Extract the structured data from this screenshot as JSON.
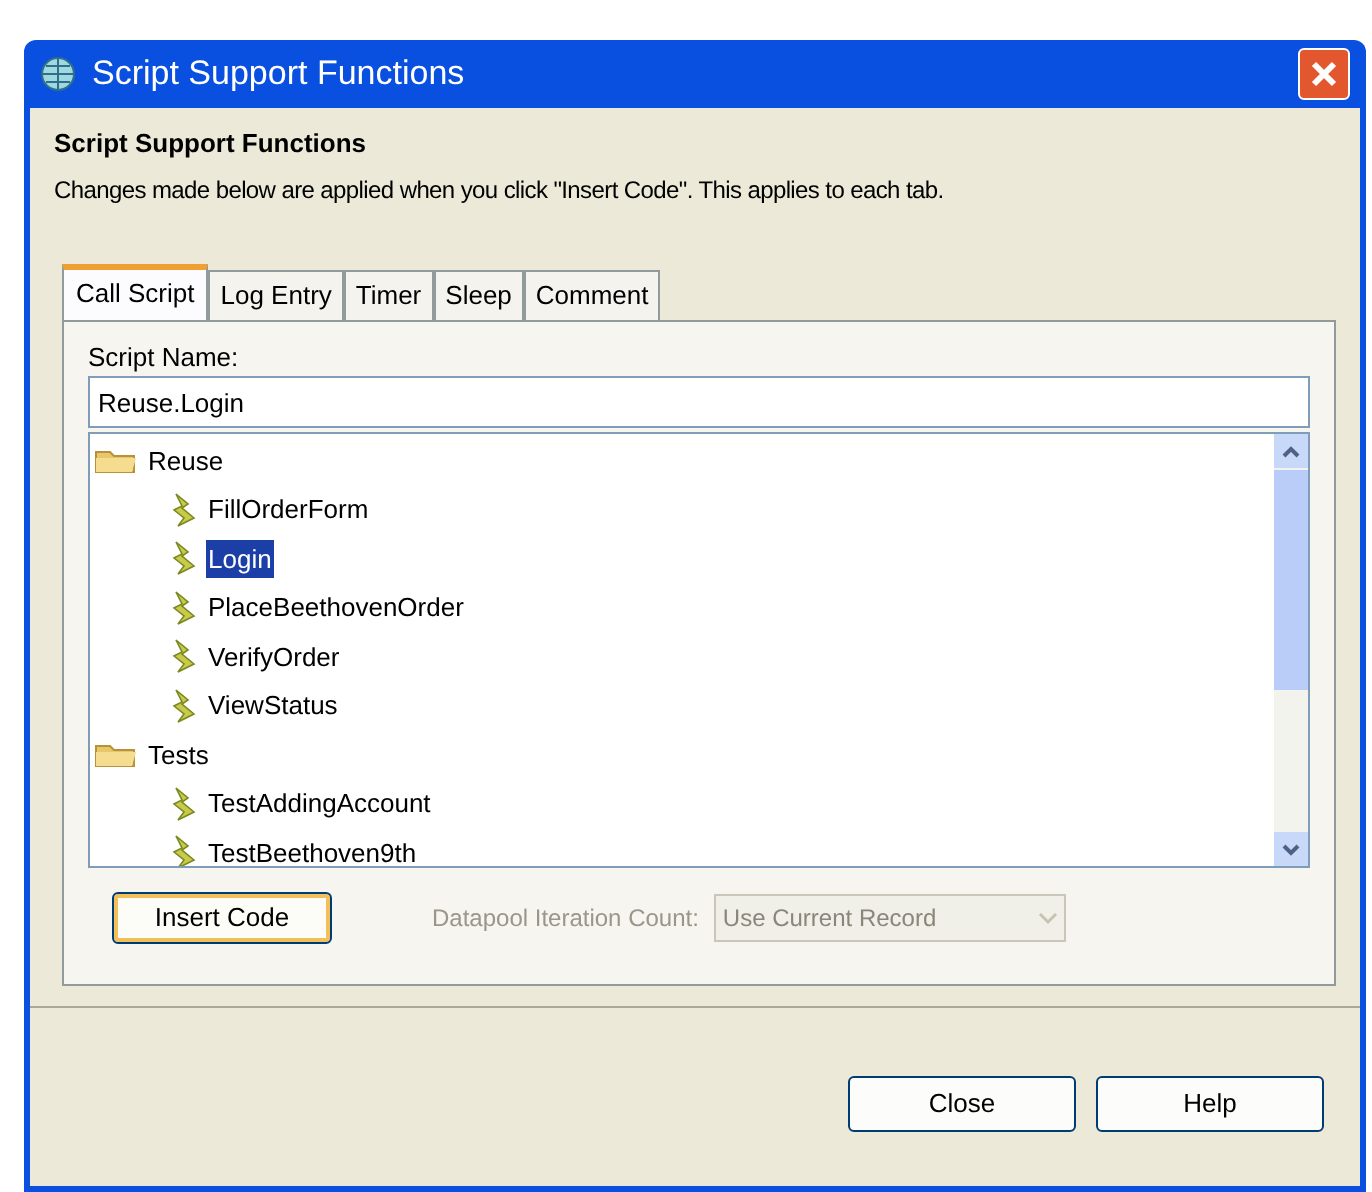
{
  "window": {
    "title": "Script Support Functions"
  },
  "header": {
    "title": "Script Support Functions",
    "description": "Changes made below are applied when you click \"Insert Code\". This applies to each tab."
  },
  "tabs": [
    {
      "label": "Call Script",
      "selected": true
    },
    {
      "label": "Log Entry",
      "selected": false
    },
    {
      "label": "Timer",
      "selected": false
    },
    {
      "label": "Sleep",
      "selected": false
    },
    {
      "label": "Comment",
      "selected": false
    }
  ],
  "script_name": {
    "label": "Script Name:",
    "value": "Reuse.Login"
  },
  "tree": [
    {
      "label": "Reuse",
      "kind": "folder",
      "selected": false,
      "children": [
        {
          "label": "FillOrderForm",
          "kind": "script",
          "selected": false
        },
        {
          "label": "Login",
          "kind": "script",
          "selected": true
        },
        {
          "label": "PlaceBeethovenOrder",
          "kind": "script",
          "selected": false
        },
        {
          "label": "VerifyOrder",
          "kind": "script",
          "selected": false
        },
        {
          "label": "ViewStatus",
          "kind": "script",
          "selected": false
        }
      ]
    },
    {
      "label": "Tests",
      "kind": "folder",
      "selected": false,
      "children": [
        {
          "label": "TestAddingAccount",
          "kind": "script",
          "selected": false
        },
        {
          "label": "TestBeethoven9th",
          "kind": "script",
          "selected": false
        }
      ]
    }
  ],
  "insert_button": "Insert Code",
  "datapool": {
    "label": "Datapool Iteration Count:",
    "value": "Use Current Record",
    "disabled": true
  },
  "buttons": [
    "Close",
    "Help"
  ]
}
